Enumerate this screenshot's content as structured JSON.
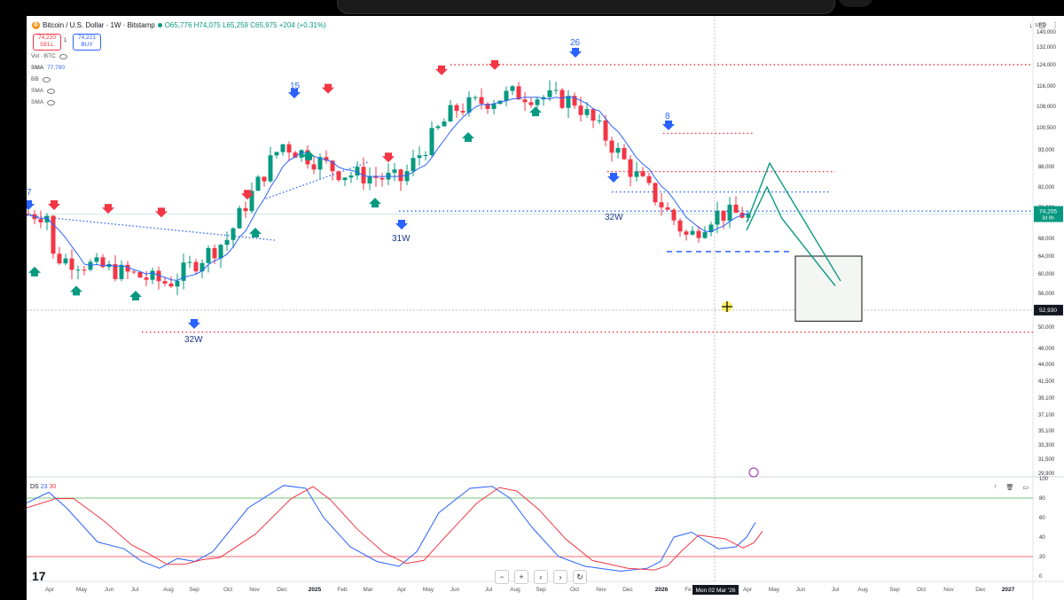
{
  "header": {
    "symbol": "Bitcoin / U.S. Dollar · 1W · Bitstamp",
    "ohlc": "O65,776 H74,075 L65,259 C65,975 +204 (+0.31%)",
    "sell_price": "74,220",
    "sell_label": "SELL",
    "spread": "1",
    "buy_price": "74,221",
    "buy_label": "BUY",
    "currency": "USD"
  },
  "indicators": [
    {
      "label": "Vol · BTC",
      "value": ""
    },
    {
      "label": "SMA",
      "value": "77,790"
    },
    {
      "label": "BB",
      "value": ""
    },
    {
      "label": "SMA",
      "value": ""
    },
    {
      "label": "SMA",
      "value": ""
    }
  ],
  "oscillator": {
    "name": "DS",
    "v1": "23",
    "v2": "30"
  },
  "price_axis": {
    "ticks": [
      "140,000",
      "132,000",
      "124,000",
      "116,000",
      "108,000",
      "100,500",
      "93,000",
      "88,000",
      "82,000",
      "76,000",
      "68,000",
      "64,000",
      "60,000",
      "56,000",
      "50,000",
      "46,000",
      "44,000",
      "41,500",
      "39,100",
      "37,100",
      "35,100",
      "33,300",
      "31,500",
      "29,900"
    ],
    "current_price": "74,205",
    "countdown": "3d 8h",
    "crosshair_price": "52,930"
  },
  "osc_axis": {
    "ticks": [
      "100",
      "80",
      "60",
      "40",
      "20",
      "0"
    ]
  },
  "time_axis": {
    "labels": [
      "Apr",
      "May",
      "Jun",
      "Jul",
      "Aug",
      "Sep",
      "Oct",
      "Nov",
      "Dec",
      "2025",
      "Feb",
      "Mar",
      "Apr",
      "May",
      "Jun",
      "Jul",
      "Aug",
      "Sep",
      "Oct",
      "Nov",
      "Dec",
      "2026",
      "Fe",
      "Apr",
      "May",
      "Jun",
      "Jul",
      "Aug",
      "Sep",
      "Oct",
      "Nov",
      "Dec",
      "2027"
    ],
    "crosshair_date": "Mon 02 Mar '26"
  },
  "annotations": [
    "7",
    "15",
    "26",
    "8",
    "31W",
    "32W",
    "32W"
  ],
  "chart_data": {
    "type": "candlestick",
    "title": "Bitcoin / U.S. Dollar · 1W · Bitstamp",
    "price_scale": "log",
    "y_range": [
      29900,
      140000
    ],
    "x_range": [
      "2024-04",
      "2027-01"
    ],
    "approx_closes": [
      {
        "date": "2024-04",
        "close": 64000
      },
      {
        "date": "2024-06",
        "close": 61000
      },
      {
        "date": "2024-08",
        "close": 58000
      },
      {
        "date": "2024-10",
        "close": 68000
      },
      {
        "date": "2024-12",
        "close": 95000
      },
      {
        "date": "2025-02",
        "close": 86000
      },
      {
        "date": "2025-04",
        "close": 84000
      },
      {
        "date": "2025-06",
        "close": 107000
      },
      {
        "date": "2025-08",
        "close": 113000
      },
      {
        "date": "2025-10",
        "close": 110000
      },
      {
        "date": "2025-12",
        "close": 88000
      },
      {
        "date": "2026-02",
        "close": 68000
      },
      {
        "date": "2026-03",
        "close": 74205
      }
    ],
    "horizontal_levels": [
      124000,
      98500,
      86500,
      80500,
      75000,
      65000,
      49000
    ],
    "projection_box": {
      "from": "2026-05",
      "to": "2026-07",
      "low": 51000,
      "high": 64000
    },
    "oscillator_bands": [
      80,
      20
    ],
    "colors": {
      "up": "#089981",
      "down": "#f23645",
      "sma": "#2962ff",
      "level_red": "#f23645",
      "level_blue": "#2962ff",
      "projection": "#089981"
    }
  }
}
